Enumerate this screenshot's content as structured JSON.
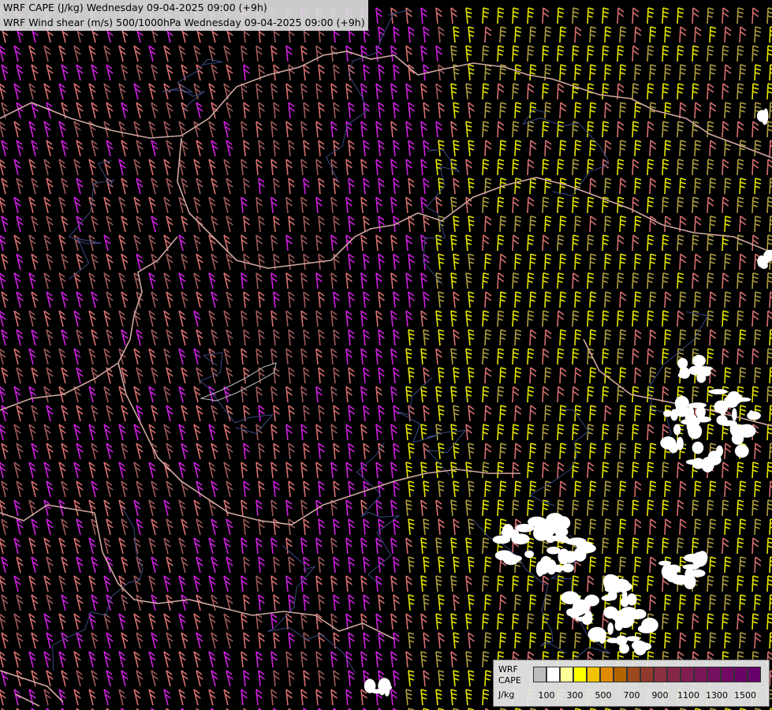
{
  "title": {
    "line1": "WRF CAPE (J/kg) Wednesday 09-04-2025 09:00 (+9h)",
    "line2": "WRF Wind shear (m/s) 500/1000hPa Wednesday 09-04-2025 09:00 (+9h)"
  },
  "legend": {
    "label_line1": "WRF",
    "label_line2": "CAPE",
    "label_line3": "J/kg",
    "swatch_colors": [
      "#bdbdbd",
      "#ffffff",
      "#ffff99",
      "#ffff00",
      "#f2c200",
      "#e08a00",
      "#b26400",
      "#9a4a1e",
      "#8f3a2c",
      "#8a3040",
      "#85284a",
      "#801e52",
      "#7a1658",
      "#75105e",
      "#700a62",
      "#6a0566",
      "#65006a"
    ],
    "tick_labels": [
      "100",
      "300",
      "500",
      "700",
      "900",
      "1100",
      "1300",
      "1500"
    ]
  },
  "colors": {
    "magenta": "#d020e0",
    "salmon": "#d87070",
    "dull_pink": "#a05a5a",
    "yellow": "#e8e800",
    "olive": "#b0a040",
    "border": "#d0a8a0",
    "river": "#3a4a80",
    "cape_fill": "#ffffff"
  }
}
